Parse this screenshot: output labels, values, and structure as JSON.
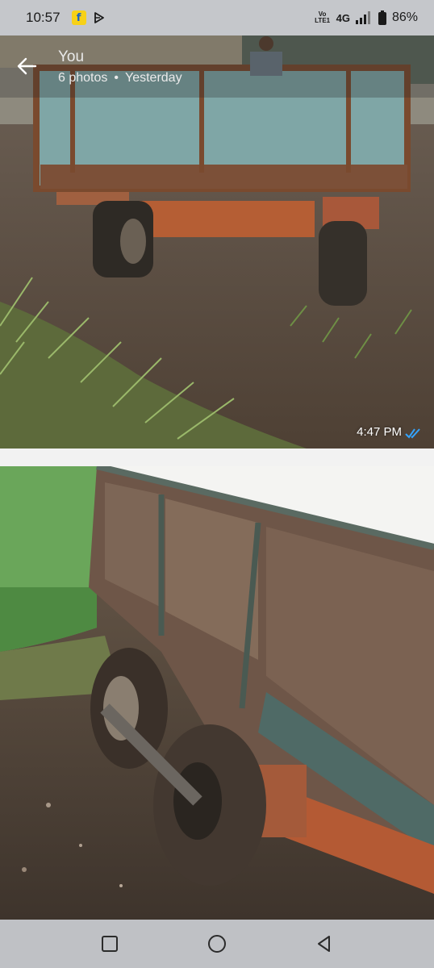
{
  "status_bar": {
    "time": "10:57",
    "notification_icons": [
      "flipkart-icon",
      "play-icon"
    ],
    "network_label": "Vo LTE1",
    "network_type": "4G",
    "battery": "86%"
  },
  "header": {
    "sender": "You",
    "photo_count": "6 photos",
    "separator": "•",
    "date": "Yesterday"
  },
  "photos": [
    {
      "subject": "rusty farm trailer rear view",
      "timestamp": "4:47 PM",
      "status_icon": "double-check-icon",
      "status_color": "#34a4ff"
    },
    {
      "subject": "rusty farm trailer side view with muddy wheels"
    }
  ],
  "nav_bar": {
    "buttons": [
      "recent-apps-icon",
      "home-icon",
      "back-icon"
    ]
  }
}
